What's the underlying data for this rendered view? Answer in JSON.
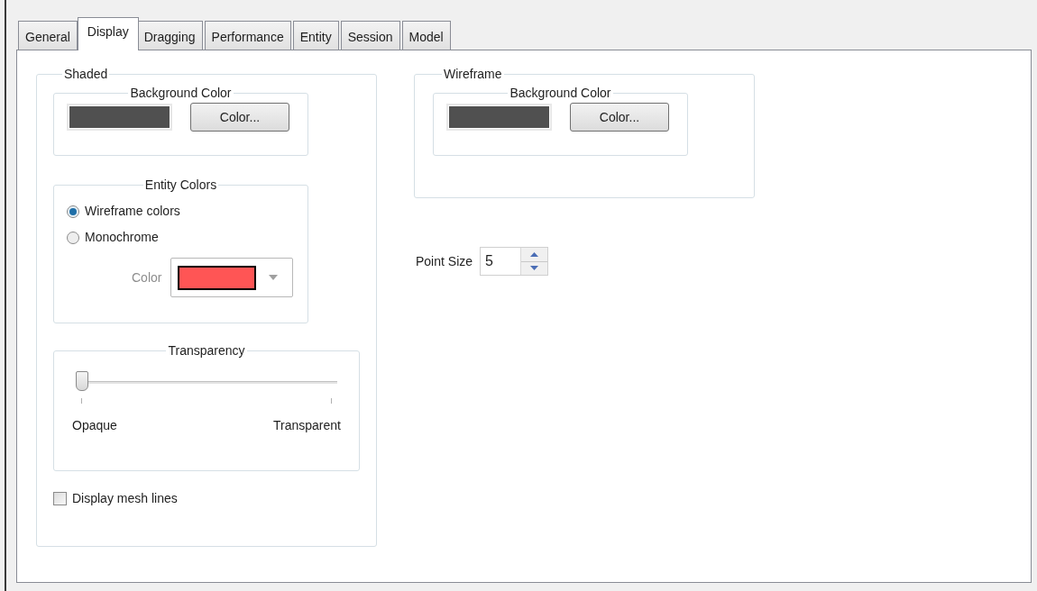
{
  "tabs": [
    {
      "label": "General",
      "selected": false
    },
    {
      "label": "Display",
      "selected": true
    },
    {
      "label": "Dragging",
      "selected": false
    },
    {
      "label": "Performance",
      "selected": false
    },
    {
      "label": "Entity",
      "selected": false
    },
    {
      "label": "Session",
      "selected": false
    },
    {
      "label": "Model",
      "selected": false
    }
  ],
  "shaded": {
    "title": "Shaded",
    "background_color": {
      "title": "Background Color",
      "color": "#505050",
      "button": "Color..."
    },
    "entity_colors": {
      "title": "Entity Colors",
      "options": [
        {
          "label": "Wireframe colors",
          "selected": true
        },
        {
          "label": "Monochrome",
          "selected": false
        }
      ],
      "color_label": "Color",
      "color": "#ff5555",
      "disabled": true
    },
    "transparency": {
      "title": "Transparency",
      "level": 0,
      "min_label": "Opaque",
      "max_label": "Transparent"
    },
    "display_mesh_lines": {
      "label": "Display mesh lines",
      "checked": false
    }
  },
  "wireframe": {
    "title": "Wireframe",
    "background_color": {
      "title": "Background Color",
      "color": "#505050",
      "button": "Color..."
    }
  },
  "point_size": {
    "label": "Point Size",
    "value": "5"
  }
}
